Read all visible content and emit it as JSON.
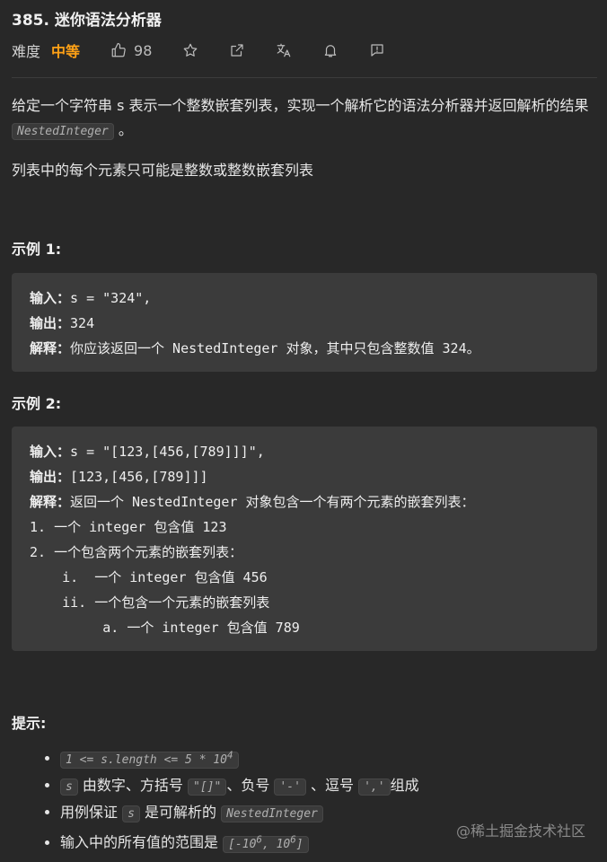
{
  "problem": {
    "title": "385. 迷你语法分析器",
    "difficulty_label": "难度",
    "difficulty": "中等",
    "likes": "98"
  },
  "description": {
    "p1_before": "给定一个字符串 s 表示一个整数嵌套列表，实现一个解析它的语法分析器并返回解析的结果 ",
    "p1_code": "NestedInteger",
    "p1_after": " 。",
    "p2": "列表中的每个元素只可能是整数或整数嵌套列表"
  },
  "example1": {
    "heading": "示例 1:",
    "lines": [
      {
        "label": "输入：",
        "text": "s = \"324\","
      },
      {
        "label": "输出：",
        "text": "324"
      },
      {
        "label": "解释：",
        "text": "你应该返回一个 NestedInteger 对象，其中只包含整数值 324。"
      }
    ]
  },
  "example2": {
    "heading": "示例 2:",
    "lines": [
      {
        "label": "输入：",
        "text": "s = \"[123,[456,[789]]]\","
      },
      {
        "label": "输出：",
        "text": "[123,[456,[789]]]"
      },
      {
        "label": "解释：",
        "text": "返回一个 NestedInteger 对象包含一个有两个元素的嵌套列表："
      }
    ],
    "details": [
      "1. 一个 integer 包含值 123",
      "2. 一个包含两个元素的嵌套列表：",
      "    i.  一个 integer 包含值 456",
      "    ii. 一个包含一个元素的嵌套列表",
      "         a. 一个 integer 包含值 789"
    ]
  },
  "tips": {
    "heading": "提示:",
    "t1_code": "1 <= s.length <= 5 * 10",
    "t1_sup": "4",
    "t2_code": "s",
    "t2_a": " 由数字、方括号 ",
    "t2_b": "\"[]\"",
    "t2_c": "、负号 ",
    "t2_d": "'-'",
    "t2_e": " 、逗号 ",
    "t2_f": "','",
    "t2_g": "组成",
    "t3_a": "用例保证 ",
    "t3_code": "s",
    "t3_b": " 是可解析的 ",
    "t3_code2": "NestedInteger",
    "t4_a": "输入中的所有值的范围是 ",
    "t4_code_a": "[-10",
    "t4_sup_a": "6",
    "t4_code_b": ", 10",
    "t4_sup_b": "6",
    "t4_code_c": "]"
  },
  "watermark": "@稀土掘金技术社区"
}
